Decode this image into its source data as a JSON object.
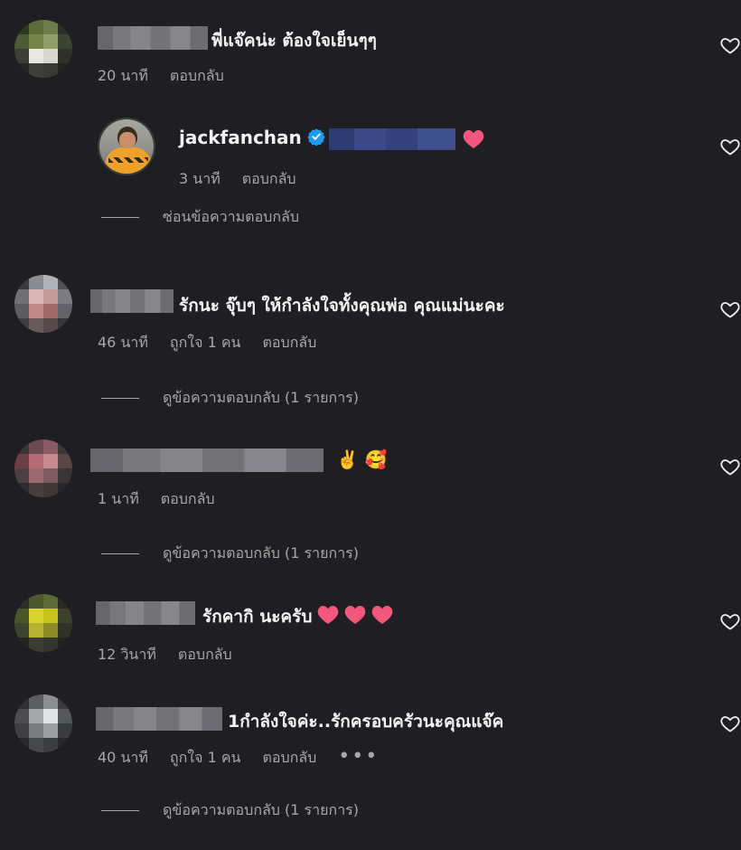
{
  "comments": [
    {
      "text": "พี่แจ๊คน่ะ ต้องใจเย็นๆๆ",
      "time": "20 นาที",
      "reply": "ตอบกลับ"
    },
    {
      "username": "jackfanchan",
      "time": "3 นาที",
      "reply": "ตอบกลับ",
      "toggle": "ซ่อนข้อความตอบกลับ"
    },
    {
      "text": "รักนะ จุ๊บๆ ให้กำลังใจทั้งคุณพ่อ คุณแม่นะคะ",
      "time": "46 นาที",
      "likes": "ถูกใจ 1 คน",
      "reply": "ตอบกลับ",
      "toggle": "ดูข้อความตอบกลับ (1 รายการ)"
    },
    {
      "text": "✌️ 🥰",
      "time": "1 นาที",
      "reply": "ตอบกลับ",
      "toggle": "ดูข้อความตอบกลับ (1 รายการ)"
    },
    {
      "text": "รักคากิ นะครับ",
      "time": "12 วินาที",
      "reply": "ตอบกลับ"
    },
    {
      "text": "1กำลังใจค่ะ..รักครอบครัวนะคุณแจ๊ค",
      "time": "40 นาที",
      "likes": "ถูกใจ 1 คน",
      "reply": "ตอบกลับ",
      "more": "•••",
      "toggle": "ดูข้อความตอบกลับ (1 รายการ)"
    }
  ],
  "colors": {
    "background": "#1f1f23",
    "text": "#f3f3f3",
    "muted": "#a8a8a8",
    "heart": "#e0245e",
    "verified": "#1d9bf0"
  }
}
